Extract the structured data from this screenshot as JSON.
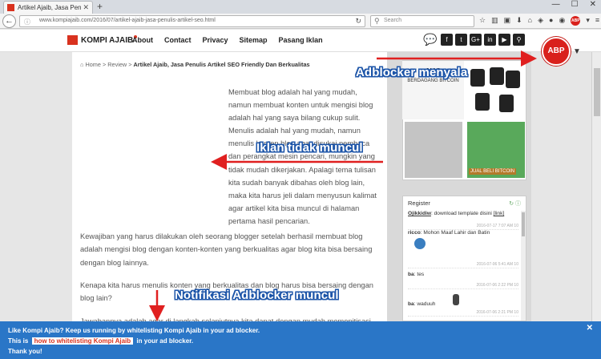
{
  "browser": {
    "tab_title": "Artikel Ajaib, Jasa Penulis A...",
    "tab_close": "✕",
    "new_tab": "+",
    "url": "www.kompiajaib.com/2016/07/artikel-ajaib-jasa-penulis-artikel-seo.html",
    "search_placeholder": "Search"
  },
  "site": {
    "logo_text": "KOMPI AJAIB",
    "menu": [
      "About",
      "Contact",
      "Privacy",
      "Sitemap",
      "Pasang Iklan"
    ],
    "social_icons": [
      "chat-icon",
      "facebook-icon",
      "twitter-icon",
      "google-plus-icon",
      "linkedin-icon",
      "youtube-icon",
      "search-icon"
    ],
    "abp_label": "ABP"
  },
  "breadcrumb": {
    "home": "Home",
    "sep1": ">",
    "review": "Review",
    "sep2": ">",
    "current": "Artikel Ajaib, Jasa Penulis Artikel SEO Friendly Dan Berkualitas"
  },
  "article": {
    "p1": "Membuat blog adalah hal yang mudah, namun membuat konten untuk mengisi blog adalah hal yang saya bilang cukup sulit. Menulis adalah hal yang mudah, namun menulis konten blog agar disukai pembaca dan perangkat mesin pencari, mungkin yang tidak mudah dikerjakan. Apalagi tema tulisan kita sudah banyak dibahas oleh blog lain, maka kita harus jeli dalam menyusun kalimat agar artikel kita bisa muncul di halaman pertama hasil pencarian.",
    "p2": "Kewajiban yang harus dilakukan oleh seorang blogger setelah berhasil membuat blog adalah mengisi blog dengan konten-konten yang berkualitas agar blog kita bisa bersaing dengan blog lainnya.",
    "p3": "Kenapa kita harus menulis konten yang berkualitas dan blog harus bisa bersaing dengan blog lain?",
    "p4": "Jawabannya adalah agar di langkah selanjutnya kita dapat dengan mudah memonitisasi"
  },
  "sidebar": {
    "ad_ayo": "AYO",
    "ad_ayo_sub": "BERDAGANG BITCOIN",
    "ad_cat_text": "JUAL BELI BITCOIN",
    "shoutbox_title": "Register",
    "messages": [
      {
        "user": "Ojikkidiw",
        "text": ": download template disini",
        "link": "[link]",
        "time": "2016-07-17 7:07 AM 10"
      },
      {
        "user": "ricco",
        "text": ": Mohon Maaf Lahir dan Batin",
        "time": "2016-07-06 5:41 AM 10"
      },
      {
        "user": "ba",
        "text": ": tes",
        "time": "2016-07-06 2:22 PM 10"
      },
      {
        "user": "ba",
        "text": ": waduuh",
        "time": "2016-07-06 2:21 PM 10"
      }
    ]
  },
  "annotations": {
    "adblocker_on": "Adblocker menyala",
    "ads_hidden": "Iklan tidak muncul",
    "notice_shown": "Notifikasi Adblocker muncul"
  },
  "notice": {
    "line1": "Like Kompi Ajaib? Keep us running by whitelisting Kompi Ajaib in your ad blocker.",
    "line2_pre": "This is",
    "line2_link": "how to whitelisting Kompi Ajaib",
    "line2_post": "in your ad blocker.",
    "line3": "Thank you!",
    "close": "✕"
  },
  "colors": {
    "accent_red": "#d9211c",
    "notice_blue": "#2a76c7",
    "arrow_red": "#e02020"
  }
}
